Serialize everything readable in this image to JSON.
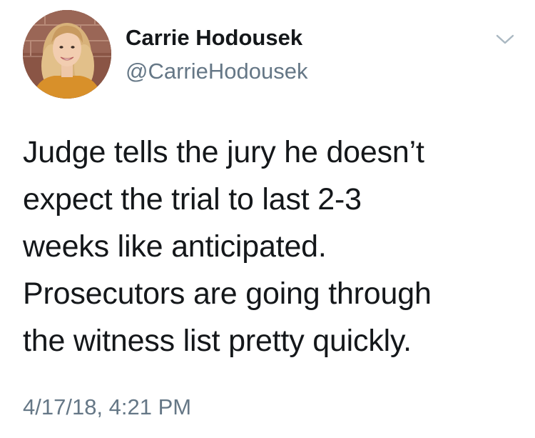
{
  "tweet": {
    "author": {
      "display_name": "Carrie Hodousek",
      "handle": "@CarrieHodousek",
      "avatar_icon": "profile-photo"
    },
    "menu_icon": "chevron-down-icon",
    "text": "Judge tells the jury he doesn’t\nexpect the trial to last 2-3\nweeks like anticipated.\nProsecutors are going through\nthe witness list pretty quickly.",
    "timestamp": "4/17/18, 4:21 PM"
  },
  "colors": {
    "primary_text": "#14171a",
    "secondary_text": "#657786",
    "caret": "#aab8c2",
    "background": "#ffffff"
  }
}
